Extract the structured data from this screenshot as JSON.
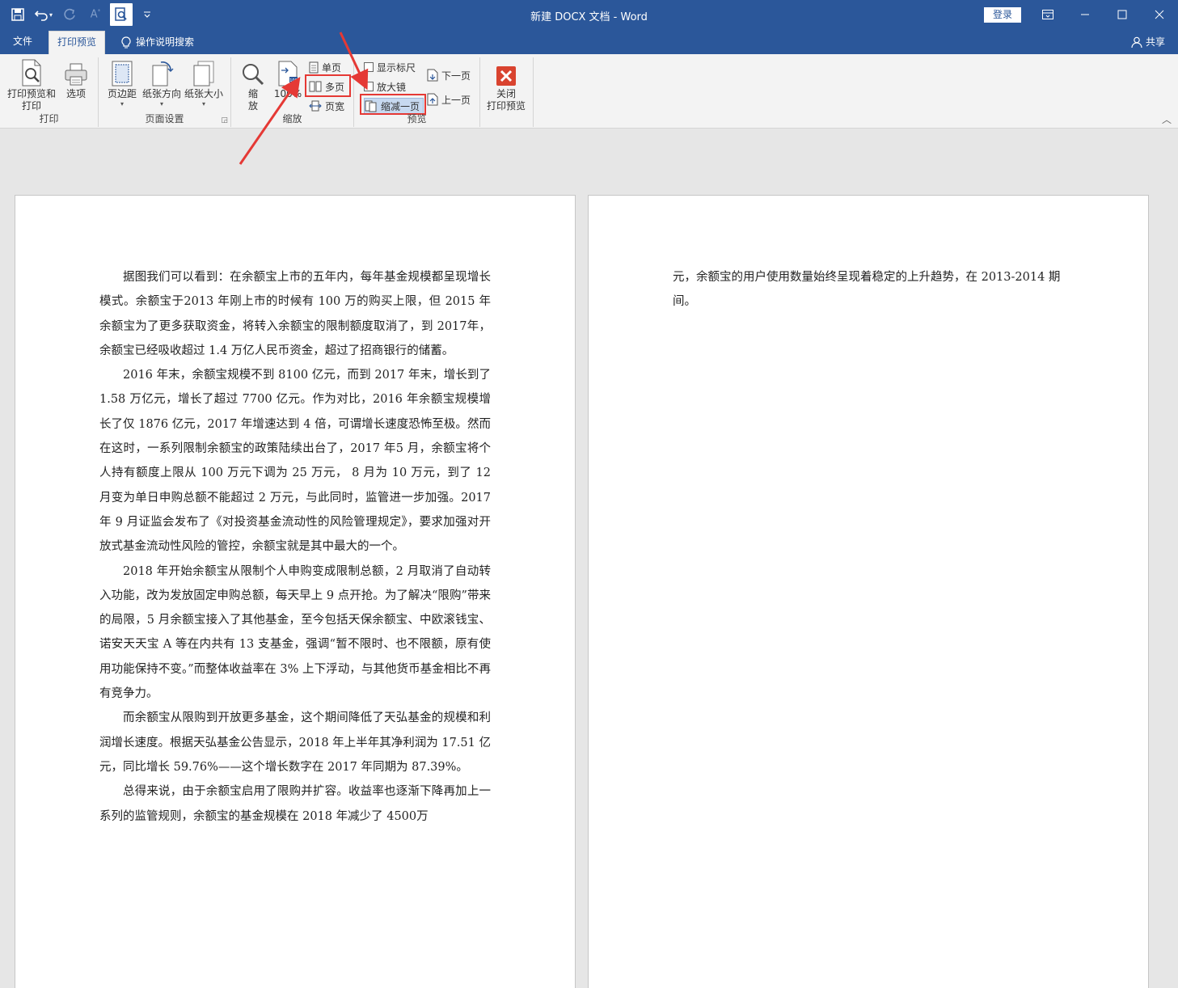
{
  "window": {
    "title": "新建 DOCX 文档  -  Word",
    "login": "登录"
  },
  "tabs": {
    "file": "文件",
    "print_preview": "打印预览",
    "tell_me": "操作说明搜索",
    "share": "共享"
  },
  "ribbon": {
    "print_group": {
      "label": "打印",
      "print_preview_print": [
        "打印预览和",
        "打印"
      ],
      "options": "选项"
    },
    "page_setup_group": {
      "label": "页面设置",
      "margins": "页边距",
      "orientation": "纸张方向",
      "size": "纸张大小"
    },
    "zoom_group": {
      "label": "缩放",
      "zoom": [
        "缩",
        "放"
      ],
      "hundred": "100%",
      "one_page": "单页",
      "multi_page": "多页",
      "page_width": "页宽"
    },
    "preview_group": {
      "label": "预览",
      "show_ruler": "显示标尺",
      "magnifier": "放大镜",
      "shrink_one_page": "缩减一页",
      "next_page": "下一页",
      "prev_page": "上一页"
    },
    "close_group": {
      "close_preview": [
        "关闭",
        "打印预览"
      ]
    }
  },
  "document": {
    "page1_paragraphs": [
      "据图我们可以看到：在余额宝上市的五年内，每年基金规模都呈现增长模式。余额宝于2013 年刚上市的时候有 100 万的购买上限，但 2015 年余额宝为了更多获取资金，将转入余额宝的限制额度取消了，到 2017年，余额宝已经吸收超过 1.4 万亿人民币资金，超过了招商银行的储蓄。",
      "2016 年末，余额宝规模不到 8100 亿元，而到 2017 年末，增长到了 1.58 万亿元，增长了超过 7700 亿元。作为对比，2016 年余额宝规模增长了仅 1876 亿元，2017 年增速达到 4 倍，可谓增长速度恐怖至极。然而在这时，一系列限制余额宝的政策陆续出台了，2017 年5 月，余额宝将个人持有额度上限从 100 万元下调为 25 万元， 8 月为 10 万元，到了 12 月变为单日申购总额不能超过 2 万元，与此同时，监管进一步加强。2017 年 9 月证监会发布了《对投资基金流动性的风险管理规定》，要求加强对开放式基金流动性风险的管控，余额宝就是其中最大的一个。",
      "2018 年开始余额宝从限制个人申购变成限制总额，2 月取消了自动转入功能，改为发放固定申购总额，每天早上 9 点开抢。为了解决“限购”带来的局限，5 月余额宝接入了其他基金，至今包括天保余额宝、中欧滚钱宝、诺安天天宝 A 等在内共有 13 支基金，强调“暂不限时、也不限额，原有使用功能保持不变。”而整体收益率在 3% 上下浮动，与其他货币基金相比不再有竞争力。",
      "而余额宝从限购到开放更多基金，这个期间降低了天弘基金的规模和利润增长速度。根据天弘基金公告显示，2018 年上半年其净利润为 17.51 亿元，同比增长 59.76%——这个增长数字在 2017 年同期为 87.39%。",
      "总得来说，由于余额宝启用了限购并扩容。收益率也逐渐下降再加上一系列的监管规则，余额宝的基金规模在 2018 年减少了 4500万"
    ],
    "page2_text": "元，余额宝的用户使用数量始终呈现着稳定的上升趋势，在 2013-2014 期间。"
  },
  "colors": {
    "titlebar": "#2b579a",
    "ribbon": "#f3f3f3",
    "annotation": "#e53935"
  }
}
